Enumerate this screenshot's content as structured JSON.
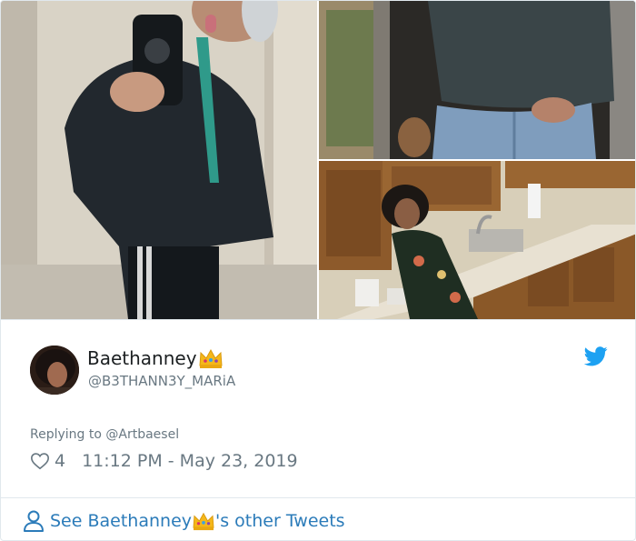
{
  "tweet": {
    "display_name": "Baethanney",
    "handle": "@B3THANN3Y_MARiA",
    "reply_prefix": "Replying to ",
    "reply_to": "@Artbaesel",
    "like_count": "4",
    "timestamp": "11:12 PM - May 23, 2019"
  },
  "footer": {
    "link_prefix": "See Baethanney",
    "link_suffix": "'s other Tweets"
  },
  "icons": {
    "verified_emoji": "crown-icon",
    "brand": "twitter-bird-icon",
    "like": "heart-icon",
    "profile": "user-icon"
  },
  "colors": {
    "link_blue": "#2b7bb9",
    "twitter_blue": "#1da1f2",
    "muted_text": "#697882",
    "border": "#e1e8ed"
  }
}
